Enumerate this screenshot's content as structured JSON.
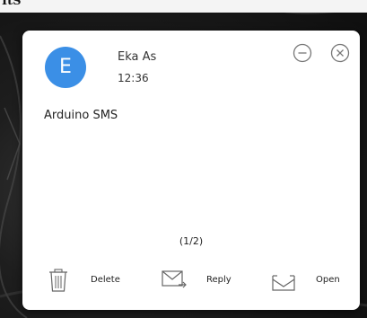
{
  "top_strip": {
    "text": "ItS"
  },
  "notification": {
    "avatar_letter": "E",
    "sender": "Eka As",
    "time": "12:36",
    "message": "Arduino SMS",
    "pager": "(1/2)",
    "accent_color": "#3b8fe6"
  },
  "controls": {
    "minimize_icon": "minus-circle-icon",
    "close_icon": "close-circle-icon"
  },
  "actions": {
    "delete_label": "Delete",
    "reply_label": "Reply",
    "open_label": "Open",
    "delete_icon": "trash-icon",
    "reply_icon": "envelope-reply-icon",
    "open_icon": "inbox-open-icon"
  }
}
